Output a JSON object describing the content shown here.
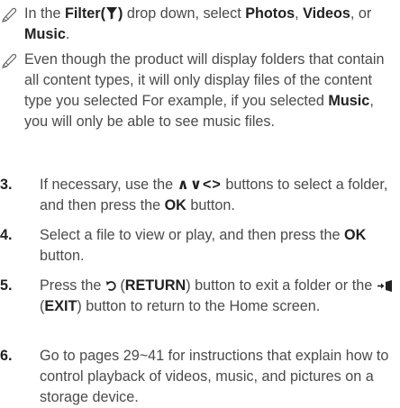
{
  "notes": [
    {
      "icon": "pencil-icon",
      "parts": {
        "a": "In the ",
        "b": "Filter(",
        "c": ")",
        "d": " drop down, select ",
        "e": "Photos",
        "f": ", ",
        "g": "Videos",
        "h": ", or ",
        "i": "Music",
        "j": "."
      }
    },
    {
      "icon": "pencil-icon",
      "parts": {
        "a": "Even though the product will display folders that contain all content types, it will only display files of the content type you selected For example, if you selected ",
        "b": "Music",
        "c": ", you will only be able to see music files."
      }
    }
  ],
  "steps": [
    {
      "number": "3.",
      "parts": {
        "a": "If necessary, use the ",
        "arrows": "∧∨<>",
        "b": " buttons to select a folder, and then press the ",
        "c": "OK",
        "d": " button."
      }
    },
    {
      "number": "4.",
      "parts": {
        "a": "Select a file to view or play, and then press the ",
        "b": "OK",
        "c": " button."
      }
    },
    {
      "number": "5.",
      "parts": {
        "a": "Press the ",
        "b": " (",
        "c": "RETURN",
        "d": ") button to exit a folder or the ",
        "e": " (",
        "f": "EXIT",
        "g": ") button to return to the Home screen."
      }
    },
    {
      "number": "6.",
      "parts": {
        "a": "Go to pages 29~41 for instructions that explain how to control playback of videos, music, and pictures on a storage device."
      }
    }
  ],
  "colors": {
    "text": "#4a4a4a",
    "emphasis": "#222222"
  }
}
